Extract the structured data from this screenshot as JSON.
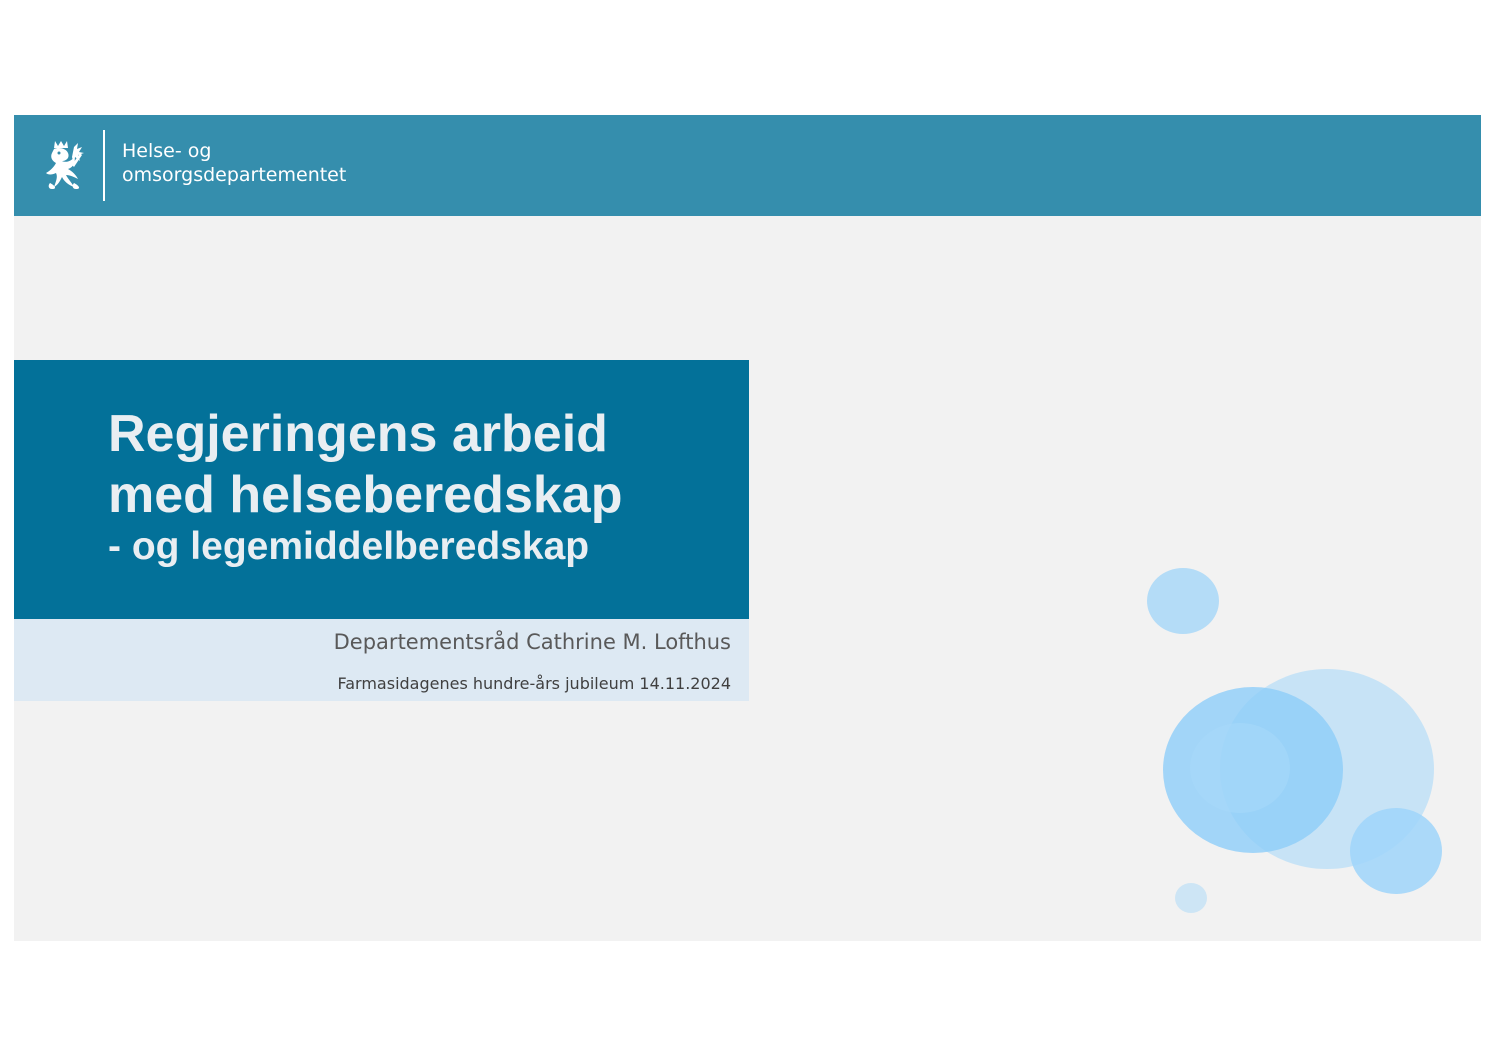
{
  "header": {
    "dept_line1": "Helse- og",
    "dept_line2": "omsorgsdepartementet",
    "logo_icon": "norwegian-lion-coat-of-arms-icon"
  },
  "title": {
    "line1": "Regjeringens arbeid",
    "line2": "med helseberedskap",
    "subtitle": "- og legemiddelberedskap"
  },
  "info": {
    "presenter": "Departementsråd Cathrine M. Lofthus",
    "event": "Farmasidagenes hundre-års jubileum 14.11.2024"
  },
  "colors": {
    "header_bar": "#358ead",
    "title_box": "#037199",
    "info_box": "#dde9f3",
    "slide_background": "#f2f2f2",
    "bubble_blue": "#7cc4f6"
  }
}
